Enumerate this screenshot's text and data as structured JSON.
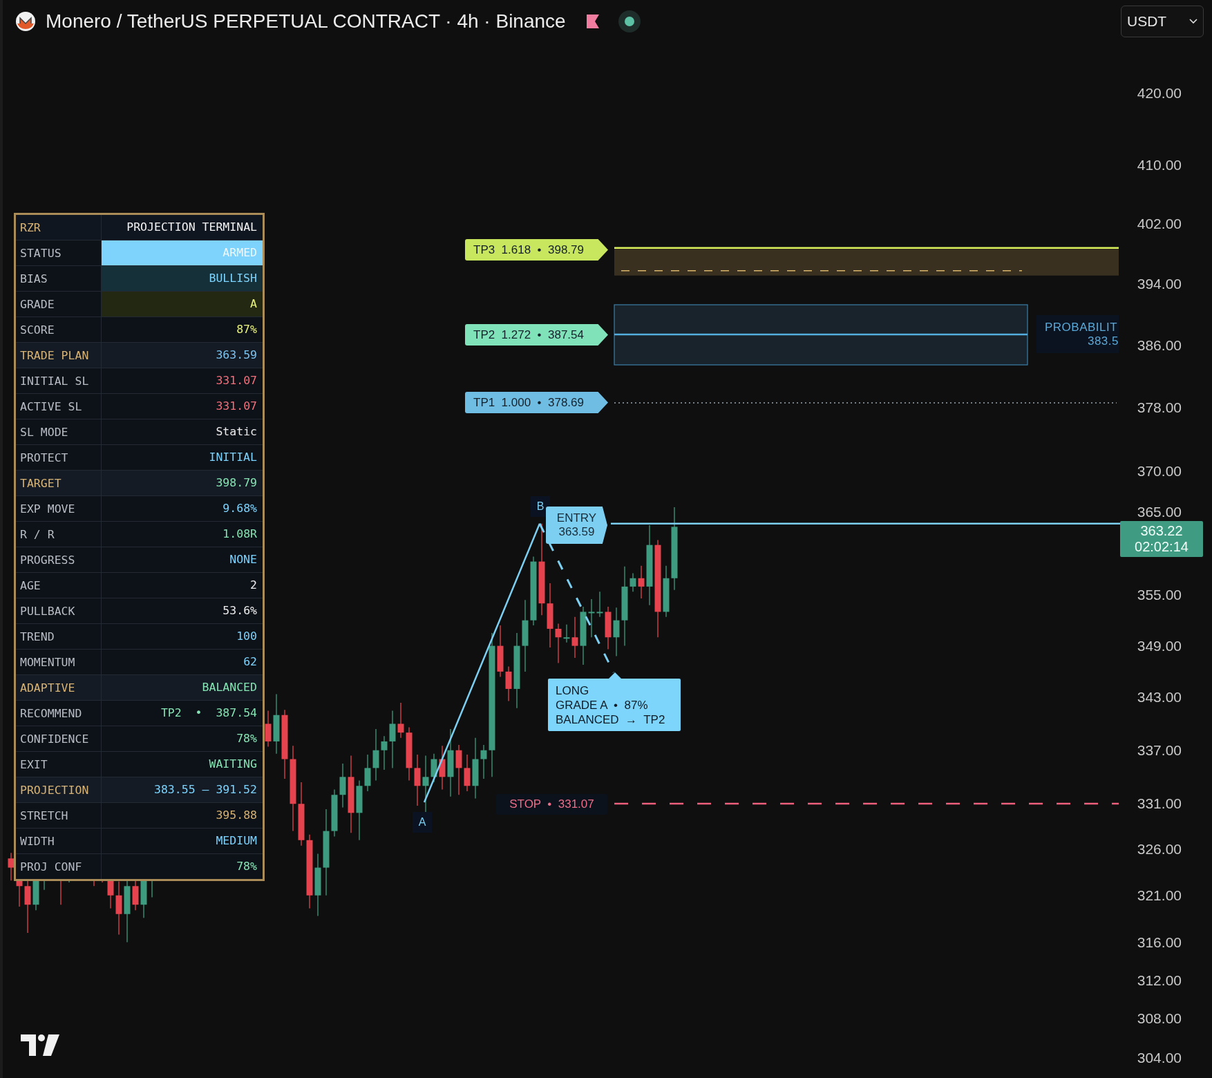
{
  "header": {
    "symbol": "Monero / TetherUS PERPETUAL CONTRACT · 4h · Binance",
    "currency": "USDT"
  },
  "terminal": {
    "rows": [
      {
        "kind": "title",
        "label": "RZR",
        "value": "PROJECTION TERMINAL",
        "color": "#f2f2f2"
      },
      {
        "kind": "filled",
        "label": "STATUS",
        "value": "ARMED",
        "color": "#eef9ff"
      },
      {
        "kind": "tinted",
        "label": "BIAS",
        "value": "BULLISH",
        "color": "#7dd3fc"
      },
      {
        "kind": "olive",
        "label": "GRADE",
        "value": "A",
        "color": "#e8f27c"
      },
      {
        "kind": "row",
        "label": "SCORE",
        "value": "87%",
        "color": "#e8f27c"
      },
      {
        "kind": "section",
        "label": "TRADE PLAN",
        "value": "363.59",
        "color": "#7cc4f0"
      },
      {
        "kind": "row",
        "label": "INITIAL SL",
        "value": "331.07",
        "color": "#f0707c"
      },
      {
        "kind": "row",
        "label": "ACTIVE SL",
        "value": "331.07",
        "color": "#f0707c"
      },
      {
        "kind": "row",
        "label": "SL MODE",
        "value": "Static",
        "color": "#ececec"
      },
      {
        "kind": "row",
        "label": "PROTECT",
        "value": "INITIAL",
        "color": "#7dd3fc"
      },
      {
        "kind": "section",
        "label": "TARGET",
        "value": "398.79",
        "color": "#86e3b4"
      },
      {
        "kind": "row",
        "label": "EXP MOVE",
        "value": "9.68%",
        "color": "#7dd3fc"
      },
      {
        "kind": "row",
        "label": "R / R",
        "value": "1.08R",
        "color": "#86e3b4"
      },
      {
        "kind": "row",
        "label": "PROGRESS",
        "value": "NONE",
        "color": "#7dd3fc"
      },
      {
        "kind": "row",
        "label": "AGE",
        "value": "2",
        "color": "#ececec"
      },
      {
        "kind": "row",
        "label": "PULLBACK",
        "value": "53.6%",
        "color": "#ececec"
      },
      {
        "kind": "row",
        "label": "TREND",
        "value": "100",
        "color": "#7dd3fc"
      },
      {
        "kind": "row",
        "label": "MOMENTUM",
        "value": "62",
        "color": "#7dd3fc"
      },
      {
        "kind": "section",
        "label": "ADAPTIVE",
        "value": "BALANCED",
        "color": "#86e3b4"
      },
      {
        "kind": "row",
        "label": "RECOMMEND",
        "value": "TP2  •  387.54",
        "color": "#86e3b4"
      },
      {
        "kind": "row",
        "label": "CONFIDENCE",
        "value": "78%",
        "color": "#86e3b4"
      },
      {
        "kind": "row",
        "label": "EXIT",
        "value": "WAITING",
        "color": "#86e3b4"
      },
      {
        "kind": "section",
        "label": "PROJECTION",
        "value": "383.55 — 391.52",
        "color": "#7dd3fc"
      },
      {
        "kind": "row",
        "label": "STRETCH",
        "value": "395.88",
        "color": "#d6b273"
      },
      {
        "kind": "row",
        "label": "WIDTH",
        "value": "MEDIUM",
        "color": "#7dd3fc"
      },
      {
        "kind": "row",
        "label": "PROJ CONF",
        "value": "78%",
        "color": "#86e3b4"
      }
    ]
  },
  "targets": [
    {
      "text": "TP3  1.618  •  398.79",
      "color": "#c8e65e"
    },
    {
      "text": "TP2  1.272  •  387.54",
      "color": "#80e2b9"
    },
    {
      "text": "TP1  1.000  •  378.69",
      "color": "#6fbde2"
    }
  ],
  "probability": {
    "title": "PROBABILIT",
    "value": "383.5"
  },
  "entry": {
    "title": "ENTRY",
    "value": "363.59"
  },
  "pivots": [
    "A",
    "B"
  ],
  "signal": {
    "lines": [
      "LONG",
      "GRADE A  •  87%",
      "BALANCED  →  TP2"
    ]
  },
  "stop": "STOP  •  331.07",
  "last_price": {
    "price": "363.22",
    "countdown": "02:02:14"
  },
  "price_axis": [
    "420.00",
    "410.00",
    "402.00",
    "394.00",
    "386.00",
    "378.00",
    "370.00",
    "365.00",
    "355.00",
    "349.00",
    "343.00",
    "337.00",
    "331.00",
    "326.00",
    "321.00",
    "316.00",
    "312.00",
    "308.00",
    "304.00"
  ]
}
